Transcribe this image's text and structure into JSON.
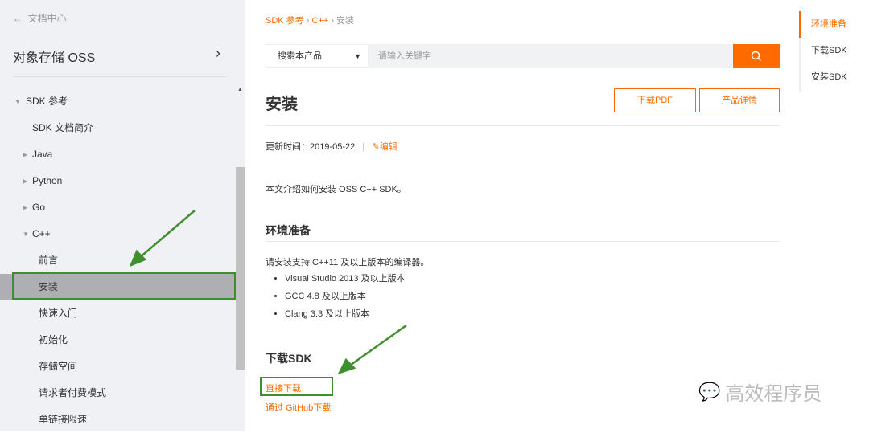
{
  "sidebar": {
    "back_label": "文档中心",
    "product": "对象存储 OSS",
    "items": [
      {
        "label": "SDK 参考",
        "level": 0,
        "expanded": true
      },
      {
        "label": "SDK 文档简介",
        "level": 1
      },
      {
        "label": "Java",
        "level": 1,
        "collapsed": true
      },
      {
        "label": "Python",
        "level": 1,
        "collapsed": true
      },
      {
        "label": "Go",
        "level": 1,
        "collapsed": true
      },
      {
        "label": "C++",
        "level": 1,
        "expanded": true
      },
      {
        "label": "前言",
        "level": 2
      },
      {
        "label": "安装",
        "level": 2,
        "active": true
      },
      {
        "label": "快速入门",
        "level": 2
      },
      {
        "label": "初始化",
        "level": 2
      },
      {
        "label": "存储空间",
        "level": 2
      },
      {
        "label": "请求者付费模式",
        "level": 2
      },
      {
        "label": "单链接限速",
        "level": 2
      }
    ]
  },
  "breadcrumb": [
    "SDK 参考",
    "C++",
    "安装"
  ],
  "search": {
    "scope": "搜索本产品",
    "placeholder": "请输入关键字"
  },
  "page": {
    "title": "安装",
    "download_pdf": "下载PDF",
    "product_details": "产品详情",
    "updated_label": "更新时间：",
    "updated": "2019-05-22",
    "edit": "编辑",
    "intro": "本文介绍如何安装 OSS C++ SDK。",
    "section1": "环境准备",
    "section1_text": "请安装支持 C++11 及以上版本的编译器。",
    "requirements": [
      "Visual Studio 2013 及以上版本",
      "GCC 4.8 及以上版本",
      "Clang 3.3 及以上版本"
    ],
    "section2": "下载SDK",
    "link_direct": "直接下载",
    "link_github": "通过 GitHub下载"
  },
  "toc": [
    "环境准备",
    "下载SDK",
    "安装SDK"
  ],
  "watermark": "高效程序员",
  "colors": {
    "accent": "#ff6a00",
    "annotation": "#3e8f2e"
  }
}
